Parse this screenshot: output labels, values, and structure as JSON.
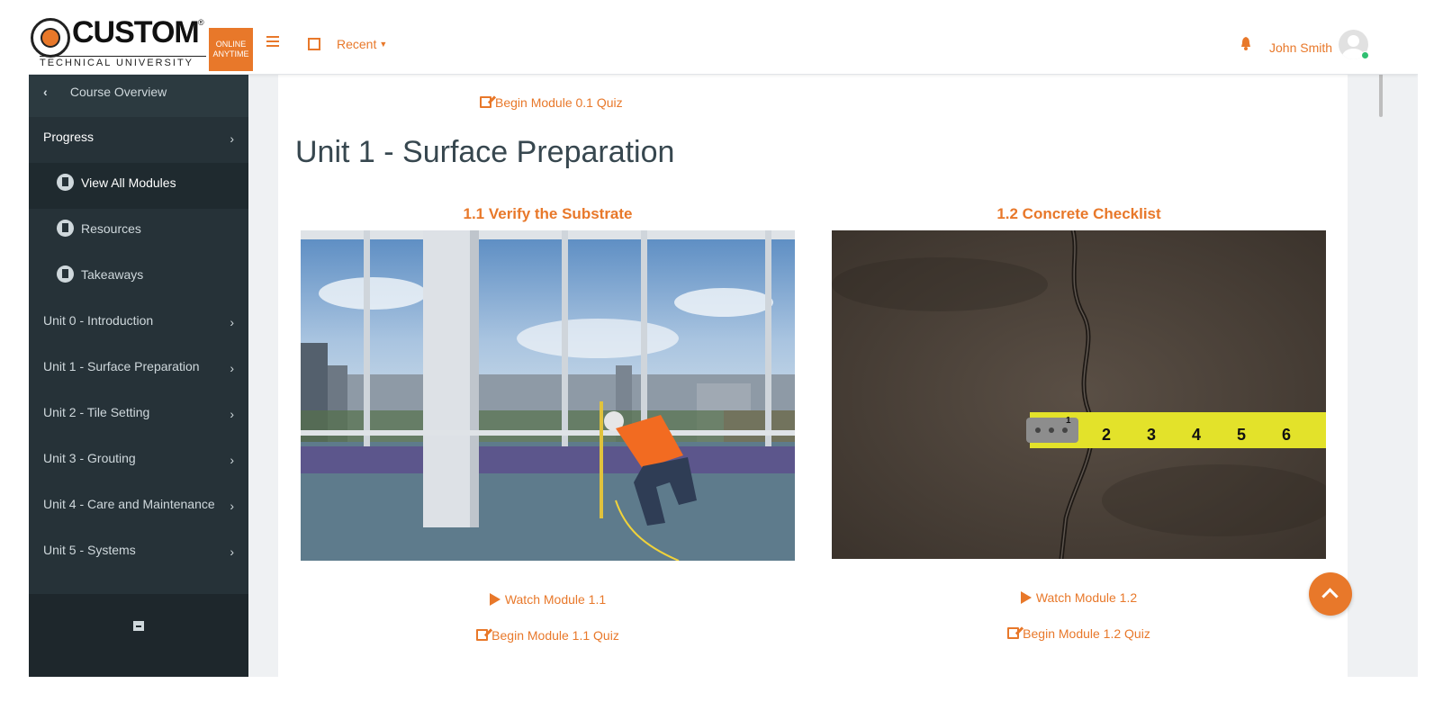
{
  "brand": {
    "logo_word": "CUSTOM",
    "logo_registered": "®",
    "logo_subtitle": "TECHNICAL UNIVERSITY",
    "badge_line1": "ONLINE",
    "badge_line2": "ANYTIME",
    "accent_color": "#e8782a"
  },
  "header": {
    "recent_label": "Recent",
    "user_name": "John Smith"
  },
  "sidebar": {
    "back_label": "Course Overview",
    "progress_label": "Progress",
    "sub_items": [
      {
        "label": "View All Modules",
        "icon": "document-icon"
      },
      {
        "label": "Resources",
        "icon": "document-icon"
      },
      {
        "label": "Takeaways",
        "icon": "document-icon"
      }
    ],
    "units": [
      {
        "label": "Unit 0 - Introduction"
      },
      {
        "label": "Unit 1 - Surface Preparation"
      },
      {
        "label": "Unit 2 - Tile Setting"
      },
      {
        "label": "Unit 3 - Grouting"
      },
      {
        "label": "Unit 4 - Care and Maintenance"
      },
      {
        "label": "Unit 5 - Systems"
      }
    ]
  },
  "content": {
    "prev_quiz_label": "Begin Module 0.1 Quiz",
    "unit_title": "Unit 1 - Surface Preparation",
    "modules": [
      {
        "title": "1.1 Verify the Substrate",
        "watch_label": "Watch Module 1.1",
        "quiz_label": "Begin Module 1.1 Quiz"
      },
      {
        "title": "1.2 Concrete Checklist",
        "watch_label": "Watch Module 1.2",
        "quiz_label": "Begin Module 1.2 Quiz"
      }
    ],
    "tape_numbers": [
      "1",
      "2",
      "3",
      "4",
      "5",
      "6"
    ]
  }
}
